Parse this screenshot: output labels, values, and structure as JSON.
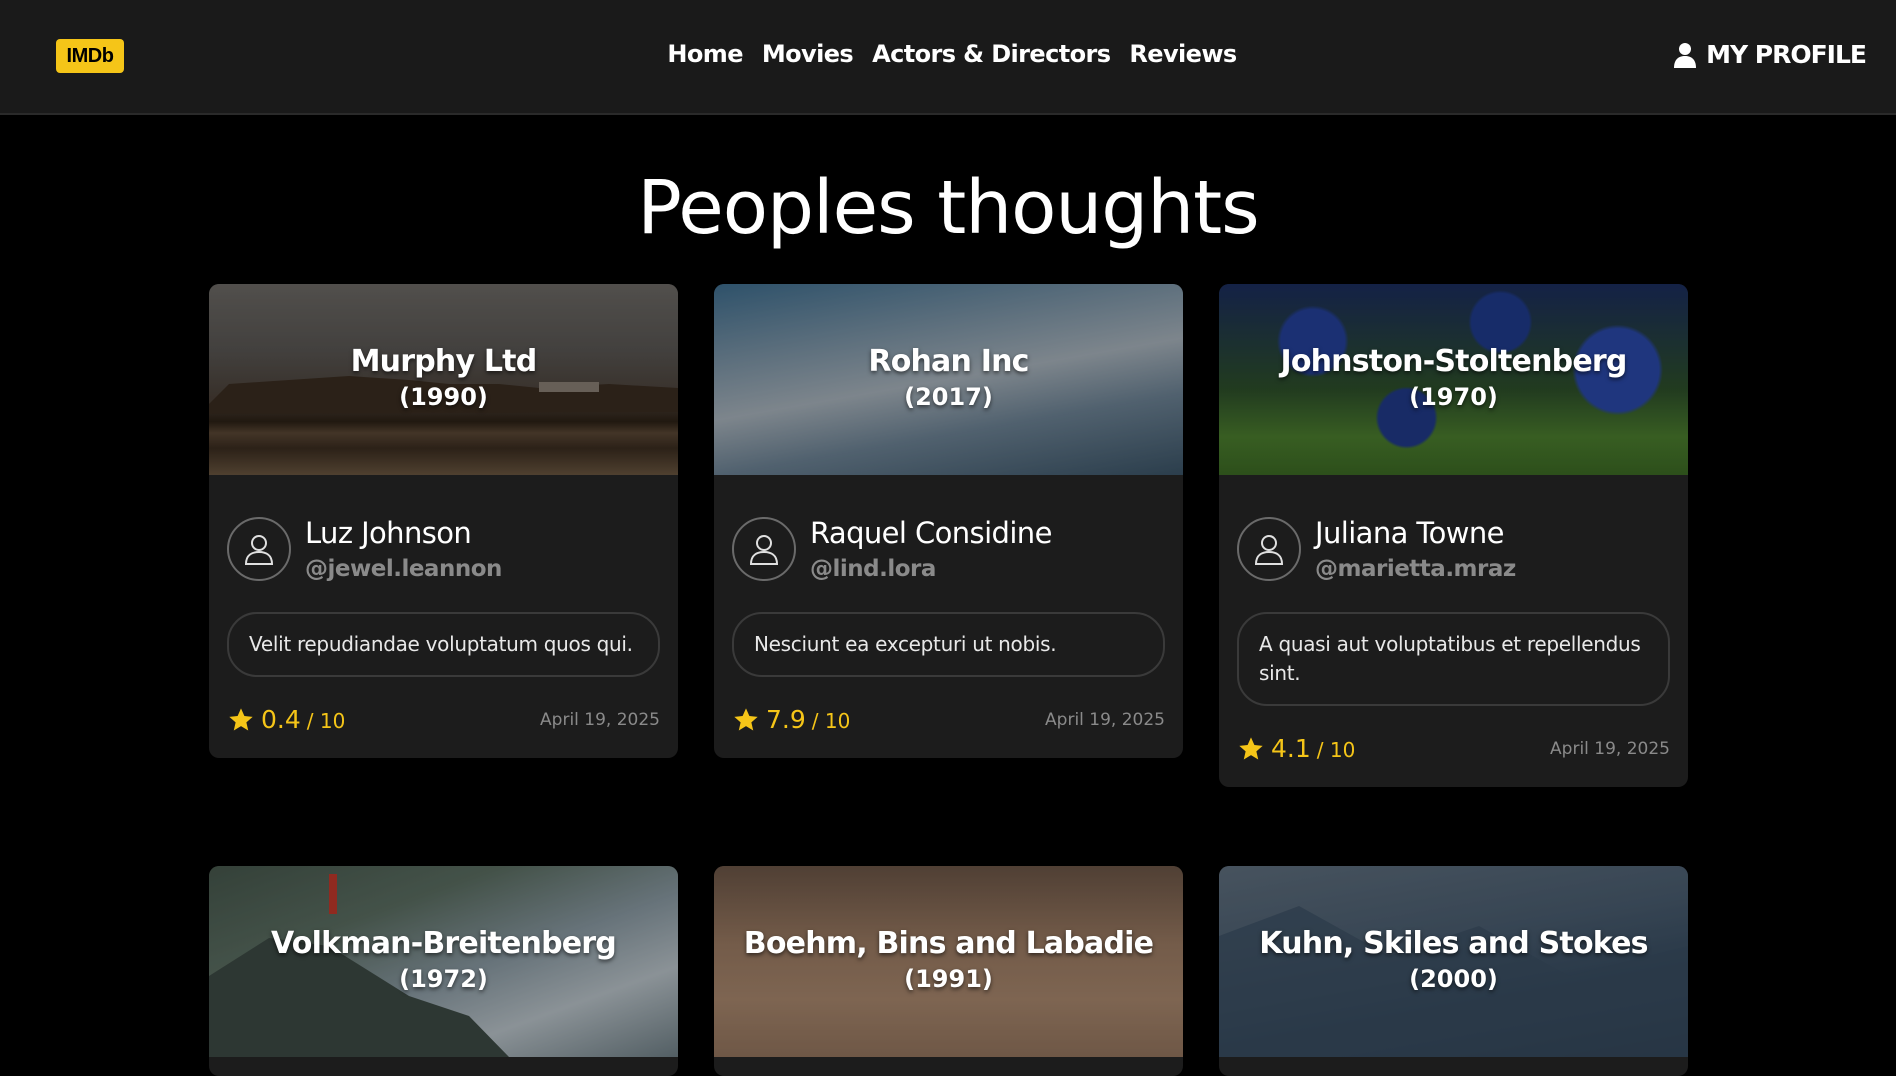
{
  "navbar": {
    "logo": "IMDb",
    "links": [
      "Home",
      "Movies",
      "Actors & Directors",
      "Reviews"
    ],
    "profile_label": "MY PROFILE",
    "profile_icon": "user-icon"
  },
  "page_title": "Peoples thoughts",
  "colors": {
    "accent": "#f5c518",
    "background": "#000000",
    "card": "#1c1c1c"
  },
  "reviews": [
    {
      "company": "Murphy Ltd",
      "year": "(1990)",
      "user_name": "Luz Johnson",
      "handle": "@jewel.leannon",
      "comment": "Velit repudiandae voluptatum quos qui.",
      "score": "0.4",
      "out_of": "/ 10",
      "date": "April 19, 2025"
    },
    {
      "company": "Rohan Inc",
      "year": "(2017)",
      "user_name": "Raquel Considine",
      "handle": "@lind.lora",
      "comment": "Nesciunt ea excepturi ut nobis.",
      "score": "7.9",
      "out_of": "/ 10",
      "date": "April 19, 2025"
    },
    {
      "company": "Johnston-Stoltenberg",
      "year": "(1970)",
      "user_name": "Juliana Towne",
      "handle": "@marietta.mraz",
      "comment": "A quasi aut voluptatibus et repellendus sint.",
      "score": "4.1",
      "out_of": "/ 10",
      "date": "April 19, 2025"
    },
    {
      "company": "Volkman-Breitenberg",
      "year": "(1972)"
    },
    {
      "company": "Boehm, Bins and Labadie",
      "year": "(1991)"
    },
    {
      "company": "Kuhn, Skiles and Stokes",
      "year": "(2000)"
    }
  ]
}
